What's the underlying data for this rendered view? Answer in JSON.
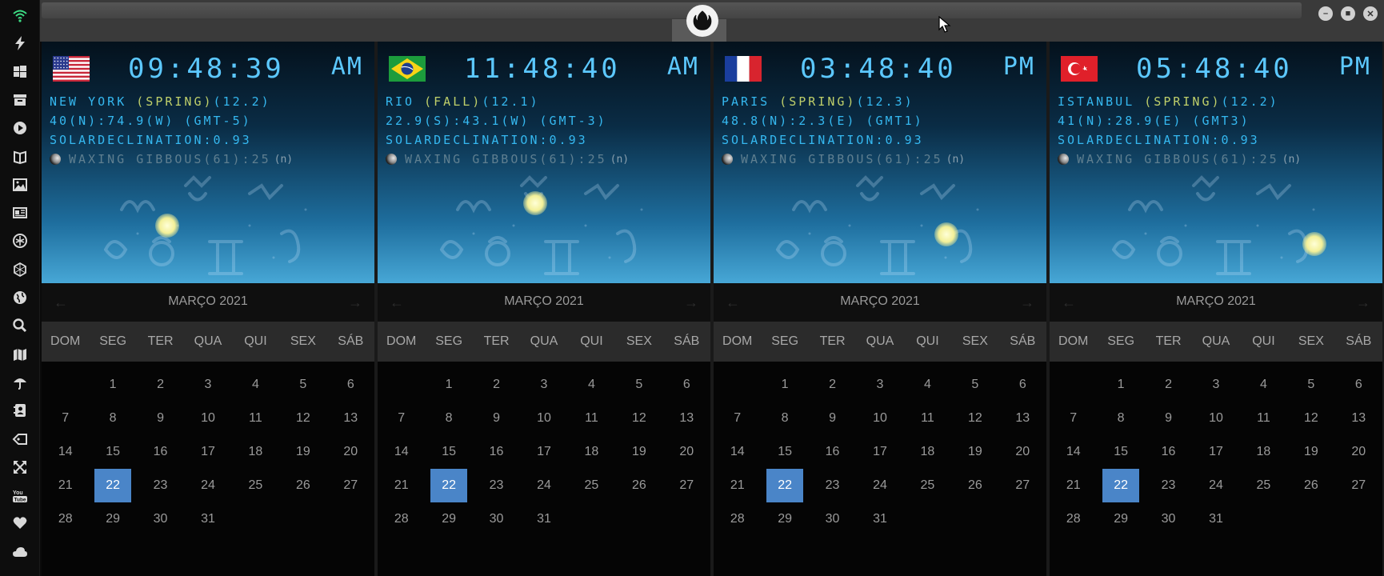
{
  "sidebar": {
    "icons": [
      "wifi-icon",
      "bolt-icon",
      "windows-icon",
      "archive-icon",
      "play-icon",
      "book-icon",
      "image-icon",
      "newspaper-icon",
      "rebel-icon",
      "network-icon",
      "globe-icon",
      "search-icon",
      "map-icon",
      "umbrella-icon",
      "contacts-icon",
      "tag-icon",
      "expand-icon",
      "youtube-icon",
      "heart-icon",
      "cloud-icon"
    ]
  },
  "topbar": {
    "emblem": "rebel-alliance-icon",
    "minimize": "–",
    "maximize": "■",
    "close": "✕"
  },
  "calendar": {
    "title": "MARÇO 2021",
    "prev": "←",
    "next": "→",
    "weekdays": [
      "DOM",
      "SEG",
      "TER",
      "QUA",
      "QUI",
      "SEX",
      "SÁB"
    ],
    "leading_blanks": 1,
    "days_in_month": 31,
    "selected_day": 22
  },
  "panels": [
    {
      "flag": "usa",
      "time": "09:48:39",
      "ampm": "AM",
      "city": "NEW YORK ",
      "season": "(SPRING)",
      "date_code": "(12.2)",
      "coords": "40(N):74.9(W) (GMT-5)",
      "solar": "SOLARDECLINATION:0.93",
      "moon": "WAXING GIBBOUS(61):25",
      "moon_n": "(n)",
      "sun_pos": [
        142,
        215
      ]
    },
    {
      "flag": "brazil",
      "time": "11:48:40",
      "ampm": "AM",
      "city": "RIO ",
      "season": "(FALL)",
      "date_code": "(12.1)",
      "coords": "22.9(S):43.1(W) (GMT-3)",
      "solar": "SOLARDECLINATION:0.93",
      "moon": "WAXING GIBBOUS(61):25",
      "moon_n": "(n)",
      "sun_pos": [
        182,
        187
      ]
    },
    {
      "flag": "france",
      "time": "03:48:40",
      "ampm": "PM",
      "city": "PARIS ",
      "season": "(SPRING)",
      "date_code": "(12.3)",
      "coords": "48.8(N):2.3(E) (GMT1)",
      "solar": "SOLARDECLINATION:0.93",
      "moon": "WAXING GIBBOUS(61):25",
      "moon_n": "(n)",
      "sun_pos": [
        276,
        226
      ]
    },
    {
      "flag": "turkey",
      "time": "05:48:40",
      "ampm": "PM",
      "city": "ISTANBUL ",
      "season": "(SPRING)",
      "date_code": "(12.2)",
      "coords": "41(N):28.9(E) (GMT3)",
      "solar": "SOLARDECLINATION:0.93",
      "moon": "WAXING GIBBOUS(61):25",
      "moon_n": "(n)",
      "sun_pos": [
        316,
        238
      ]
    }
  ]
}
